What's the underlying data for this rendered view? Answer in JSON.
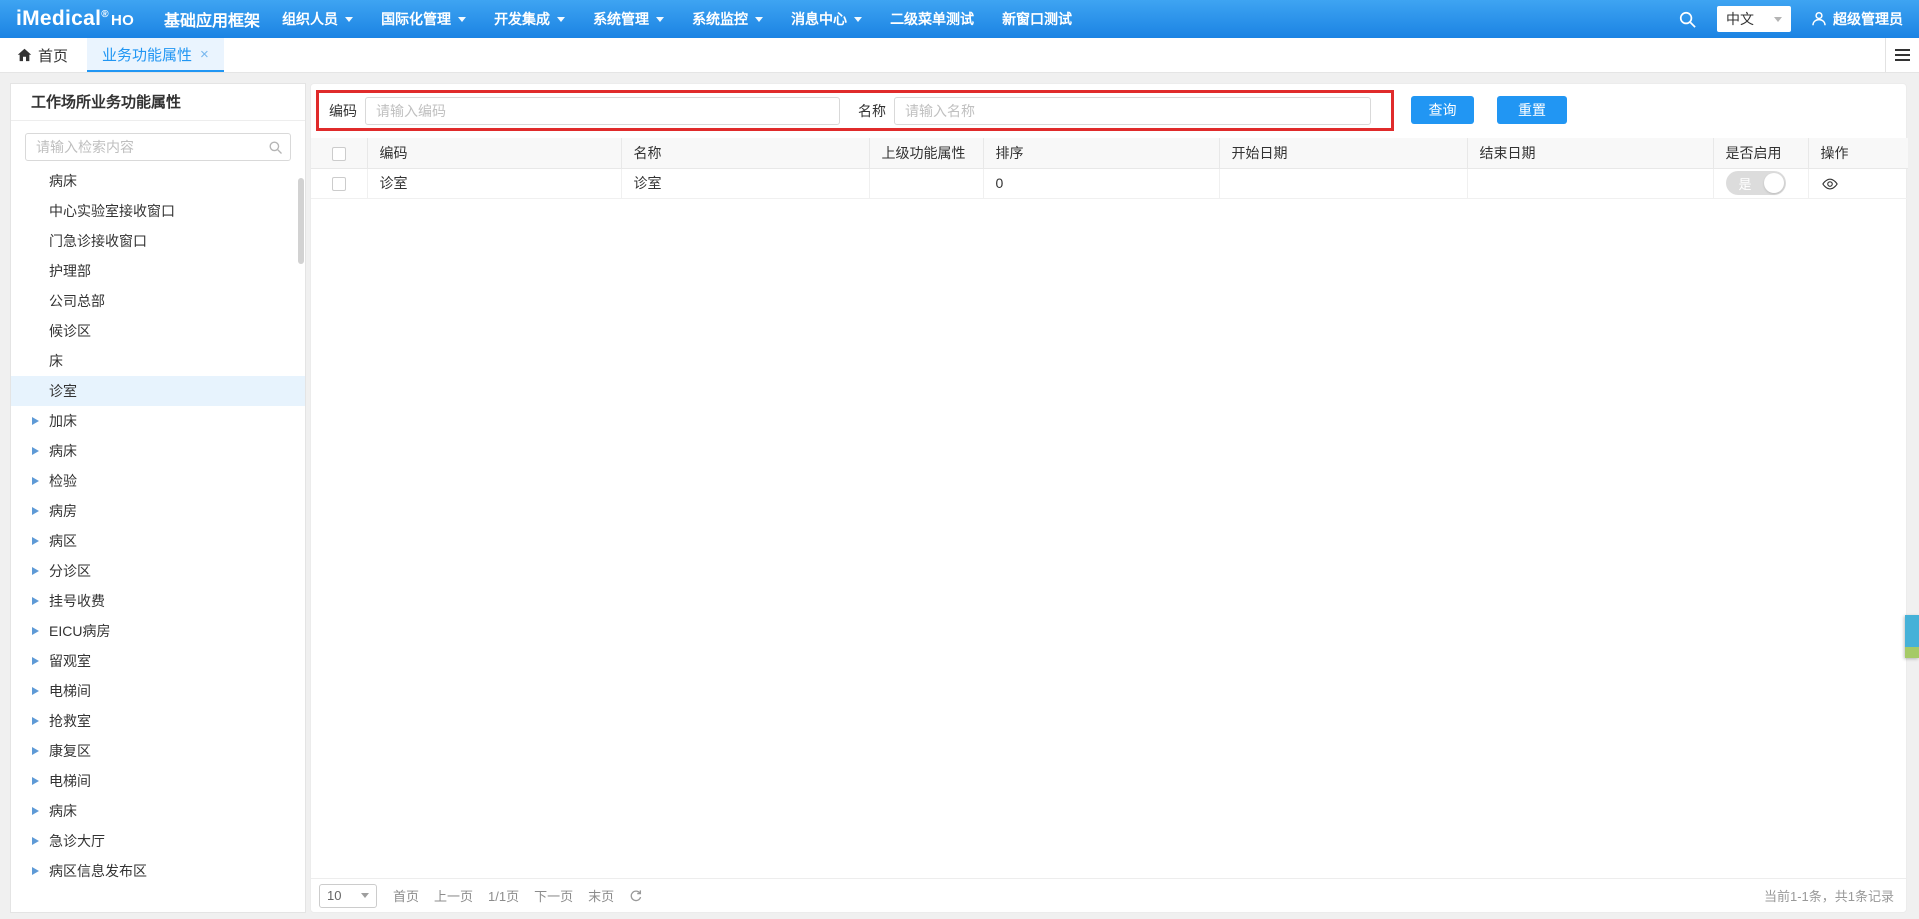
{
  "navbar": {
    "logo": "iMedical",
    "logo_reg": "®",
    "logo_ho": "HO",
    "app_title": "基础应用框架",
    "menus": [
      {
        "label": "组织人员",
        "caret": true
      },
      {
        "label": "国际化管理",
        "caret": true
      },
      {
        "label": "开发集成",
        "caret": true
      },
      {
        "label": "系统管理",
        "caret": true
      },
      {
        "label": "系统监控",
        "caret": true
      },
      {
        "label": "消息中心",
        "caret": true
      },
      {
        "label": "二级菜单测试",
        "caret": false
      },
      {
        "label": "新窗口测试",
        "caret": false
      }
    ],
    "lang": "中文",
    "user": "超级管理员"
  },
  "tabbar": {
    "home_label": "首页",
    "active_label": "业务功能属性",
    "close_glyph": "×"
  },
  "sidebar": {
    "title": "工作场所业务功能属性",
    "search_placeholder": "请输入检索内容",
    "items": [
      {
        "label": "病床",
        "expandable": false,
        "selected": false
      },
      {
        "label": "中心实验室接收窗口",
        "expandable": false,
        "selected": false
      },
      {
        "label": "门急诊接收窗口",
        "expandable": false,
        "selected": false
      },
      {
        "label": "护理部",
        "expandable": false,
        "selected": false
      },
      {
        "label": "公司总部",
        "expandable": false,
        "selected": false
      },
      {
        "label": "候诊区",
        "expandable": false,
        "selected": false
      },
      {
        "label": "床",
        "expandable": false,
        "selected": false
      },
      {
        "label": "诊室",
        "expandable": false,
        "selected": true
      },
      {
        "label": "加床",
        "expandable": true,
        "selected": false
      },
      {
        "label": "病床",
        "expandable": true,
        "selected": false
      },
      {
        "label": "检验",
        "expandable": true,
        "selected": false
      },
      {
        "label": "病房",
        "expandable": true,
        "selected": false
      },
      {
        "label": "病区",
        "expandable": true,
        "selected": false
      },
      {
        "label": "分诊区",
        "expandable": true,
        "selected": false
      },
      {
        "label": "挂号收费",
        "expandable": true,
        "selected": false
      },
      {
        "label": "EICU病房",
        "expandable": true,
        "selected": false
      },
      {
        "label": "留观室",
        "expandable": true,
        "selected": false
      },
      {
        "label": "电梯间",
        "expandable": true,
        "selected": false
      },
      {
        "label": "抢救室",
        "expandable": true,
        "selected": false
      },
      {
        "label": "康复区",
        "expandable": true,
        "selected": false
      },
      {
        "label": "电梯间",
        "expandable": true,
        "selected": false
      },
      {
        "label": "病床",
        "expandable": true,
        "selected": false
      },
      {
        "label": "急诊大厅",
        "expandable": true,
        "selected": false
      },
      {
        "label": "病区信息发布区",
        "expandable": true,
        "selected": false
      }
    ]
  },
  "toolbar": {
    "code_label": "编码",
    "code_placeholder": "请输入编码",
    "code_value": "",
    "name_label": "名称",
    "name_placeholder": "请输入名称",
    "name_value": "",
    "query_button": "查询",
    "reset_button": "重置"
  },
  "table": {
    "columns": [
      "编码",
      "名称",
      "上级功能属性",
      "排序",
      "开始日期",
      "结束日期",
      "是否启用",
      "操作"
    ],
    "rows": [
      {
        "code": "诊室",
        "name": "诊室",
        "parent": "",
        "sort": "0",
        "start_date": "",
        "end_date": "",
        "enabled_label": "是"
      }
    ]
  },
  "pagination": {
    "page_size": "10",
    "first": "首页",
    "prev": "上一页",
    "current": "1/1页",
    "next": "下一页",
    "last": "末页",
    "summary": "当前1-1条，共1条记录"
  },
  "colors": {
    "navbar_blue": "#2191ec",
    "accent_blue": "#2196f3",
    "active_tab_bg": "#eaf4fe",
    "highlight_red": "#e02b2b",
    "selected_item_bg": "#e7f3fd",
    "toggle_gray": "#dcdcdc",
    "widget_blue": "#45b1d8",
    "widget_green": "#a5ca66"
  }
}
